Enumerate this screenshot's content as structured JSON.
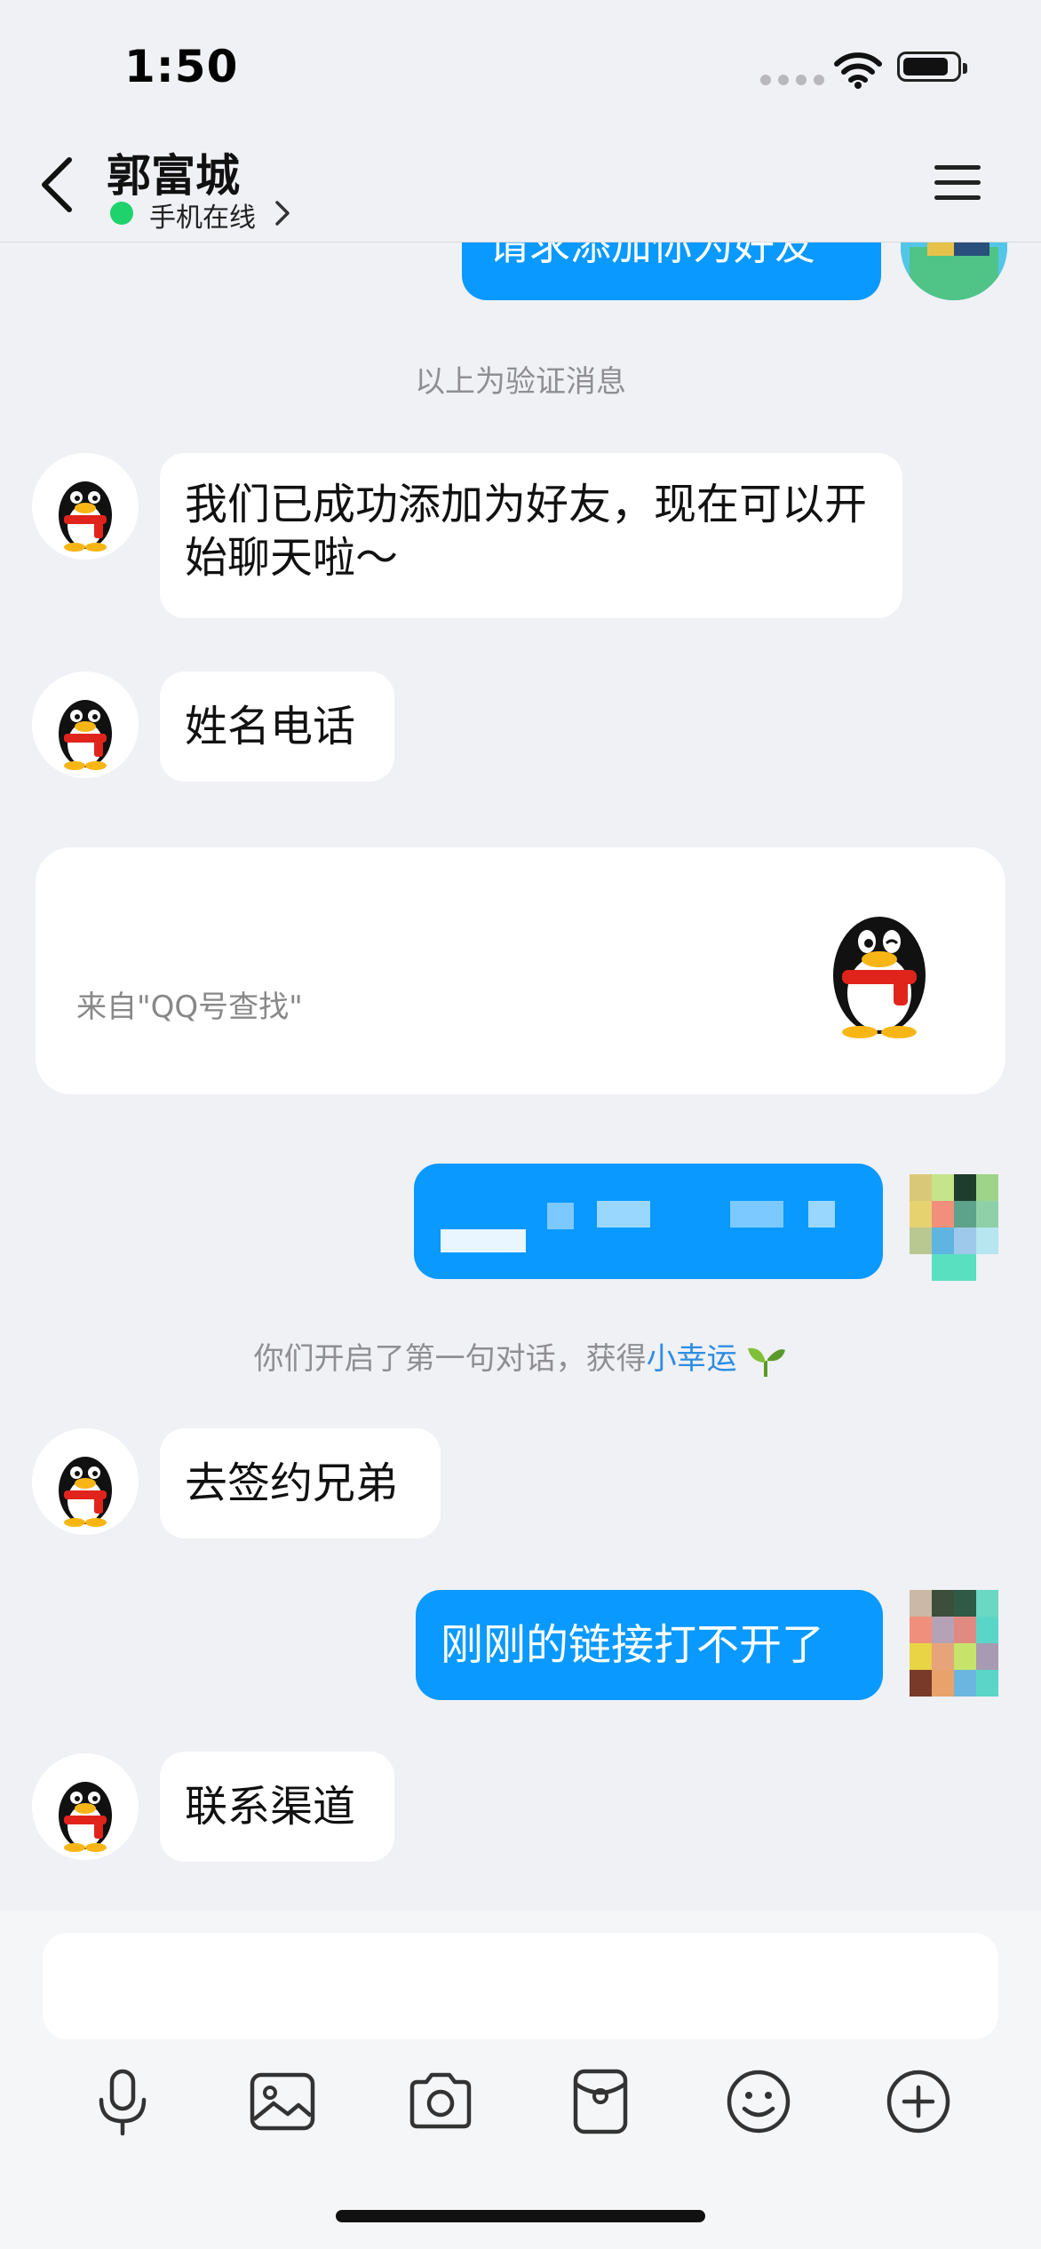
{
  "status_bar": {
    "time": "1:50"
  },
  "header": {
    "contact_name": "郭富城",
    "online_status": "手机在线"
  },
  "messages": {
    "m0_outgoing_partial": "请求添加你为好友",
    "sys_verification": "以上为验证消息",
    "m1": "我们已成功添加为好友，现在可以开始聊天啦～",
    "m2": "姓名电话",
    "card_source": "来自\"QQ号查找\"",
    "sys_first_prefix": "你们开启了第一句对话，获得",
    "sys_first_link": "小幸运",
    "m3": "去签约兄弟",
    "m4": "刚刚的链接打不开了",
    "m5": "联系渠道"
  },
  "toolbar": {
    "icons": [
      "microphone-icon",
      "image-icon",
      "camera-icon",
      "red-packet-icon",
      "emoji-icon",
      "plus-icon"
    ]
  },
  "colors": {
    "accent_blue": "#0a99ff",
    "online_green": "#1ed36b",
    "background": "#f0f1f5"
  }
}
